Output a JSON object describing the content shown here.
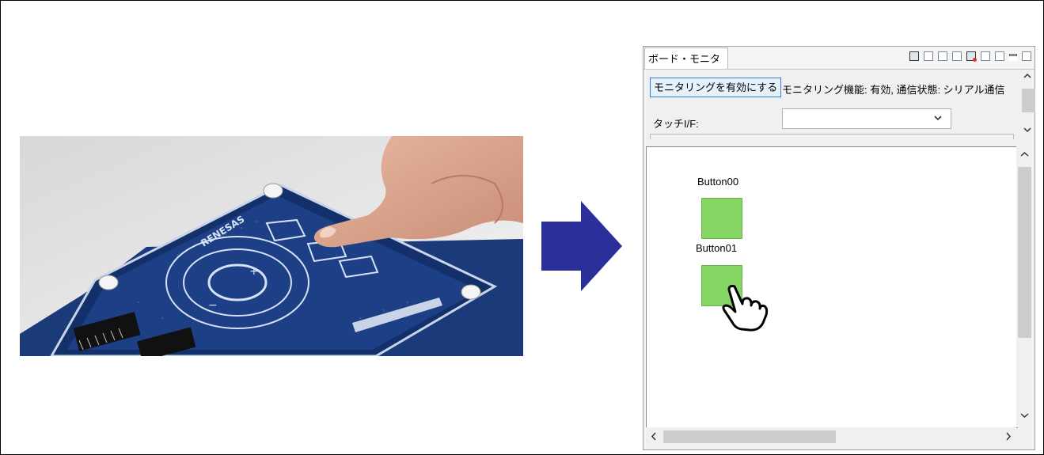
{
  "view": {
    "tab_title": "ボード・モニタ",
    "tab_close": "⊠",
    "toolbar_icons": [
      "view-icon",
      "export-icon",
      "import-icon",
      "layout-icon",
      "record-icon",
      "window-icon",
      "grid-icon",
      "minimize-icon",
      "maximize-icon"
    ],
    "enable_button": "モニタリングを有効にする",
    "status_text": "モニタリング機能: 有効, 通信状態: シリアル通信",
    "touch_if_label": "タッチI/F:",
    "touch_if_value": ""
  },
  "canvas": {
    "buttons": [
      {
        "label": "Button00",
        "color": "#86d666"
      },
      {
        "label": "Button01",
        "color": "#86d666"
      }
    ],
    "pointer": "hand-pointer-icon"
  },
  "arrow_color": "#2b2f99",
  "photo": {
    "board_brand": "RENESAS"
  }
}
